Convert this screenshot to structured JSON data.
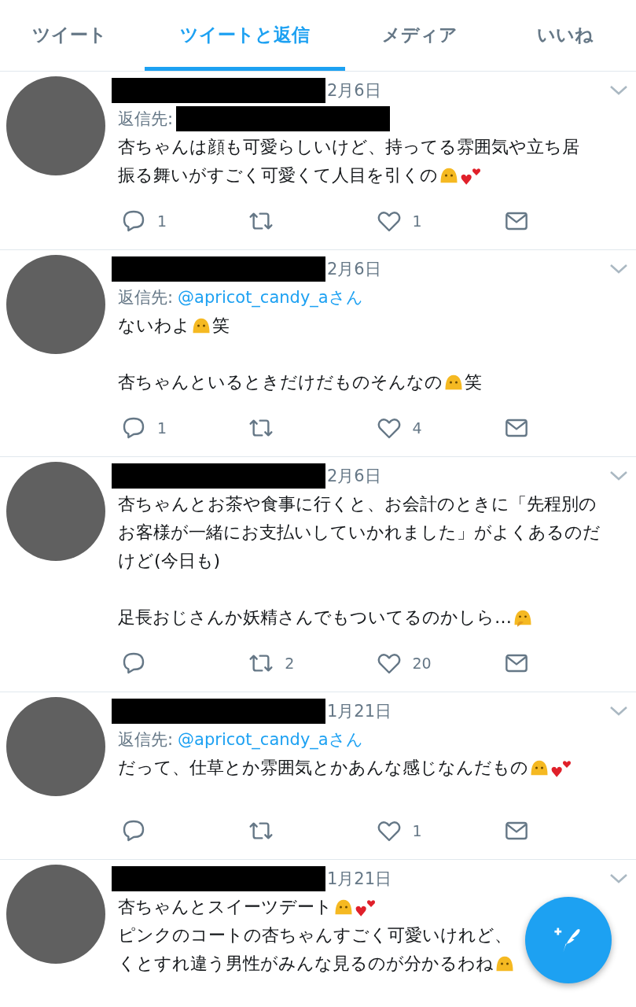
{
  "tabs": [
    {
      "label": "ツイート",
      "selected": false
    },
    {
      "label": "ツイートと返信",
      "selected": true
    },
    {
      "label": "メディア",
      "selected": false
    },
    {
      "label": "いいね",
      "selected": false
    }
  ],
  "tweets": [
    {
      "date": "2月6日",
      "reply_to": {
        "label": "返信先:",
        "handle_redacted": true
      },
      "paragraphs": [
        [
          [
            {
              "kind": "text",
              "text": "杏ちゃんは顔も可愛らしいけど、持ってる雰囲気や立ち居"
            }
          ],
          [
            {
              "kind": "text",
              "text": "振る舞いがすごく可愛くて人目を引くの"
            },
            {
              "kind": "face"
            },
            {
              "kind": "hearts"
            }
          ]
        ]
      ],
      "replies": "1",
      "likes": "1",
      "partial": false
    },
    {
      "date": "2月6日",
      "reply_to": {
        "label": "返信先:",
        "handle": "@apricot_candy_aさん",
        "handle_redacted": false
      },
      "paragraphs": [
        [
          [
            {
              "kind": "text",
              "text": "ないわよ"
            },
            {
              "kind": "face"
            },
            {
              "kind": "text",
              "text": "笑"
            }
          ]
        ],
        [
          [
            {
              "kind": "text",
              "text": "杏ちゃんといるときだけだものそんなの"
            },
            {
              "kind": "face"
            },
            {
              "kind": "text",
              "text": "笑"
            }
          ]
        ]
      ],
      "replies": "1",
      "likes": "4",
      "partial": false
    },
    {
      "date": "2月6日",
      "paragraphs": [
        [
          [
            {
              "kind": "text",
              "text": "杏ちゃんとお茶や食事に行くと、お会計のときに「先程別の"
            }
          ],
          [
            {
              "kind": "text",
              "text": "お客様が一緒にお支払いしていかれました」がよくあるのだ"
            }
          ],
          [
            {
              "kind": "text",
              "text": "けど(今日も)"
            }
          ]
        ],
        [
          [
            {
              "kind": "text",
              "text": "足長おじさんか妖精さんでもついてるのかしら…"
            },
            {
              "kind": "thinking"
            }
          ]
        ]
      ],
      "retweets": "2",
      "likes": "20",
      "partial": false
    },
    {
      "date": "1月21日",
      "reply_to": {
        "label": "返信先:",
        "handle": "@apricot_candy_aさん",
        "handle_redacted": false
      },
      "paragraphs": [
        [
          [
            {
              "kind": "text",
              "text": "だって、仕草とか雰囲気とかあんな感じなんだもの"
            },
            {
              "kind": "face"
            },
            {
              "kind": "hearts"
            }
          ]
        ]
      ],
      "likes": "1",
      "partial": false
    },
    {
      "date": "1月21日",
      "paragraphs": [
        [
          [
            {
              "kind": "text",
              "text": "杏ちゃんとスイーツデート"
            },
            {
              "kind": "face"
            },
            {
              "kind": "hearts"
            }
          ],
          [
            {
              "kind": "text",
              "text": "ピンクのコートの杏ちゃんすごく可愛いけれど、"
            }
          ],
          [
            {
              "kind": "text",
              "text": "くとすれ違う男性がみんな見るのが分かるわね"
            },
            {
              "kind": "face"
            }
          ]
        ]
      ],
      "partial": true
    }
  ]
}
